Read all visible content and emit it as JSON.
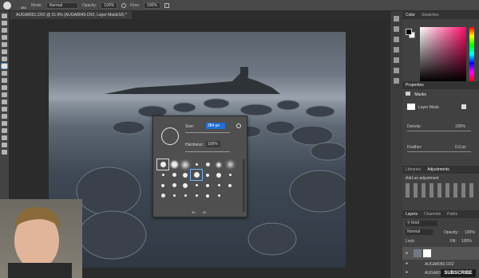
{
  "options_bar": {
    "brush_size": "384",
    "mode_label": "Mode:",
    "mode_value": "Normal",
    "opacity_label": "Opacity:",
    "opacity_value": "100%",
    "flow_label": "Flow:",
    "flow_value": "100%"
  },
  "document": {
    "tab_title": "AUGA8051.CR2 @ 31.9% (AUGA8049.CR2, Layer Mask/16) *"
  },
  "brush_popup": {
    "size_label": "Size:",
    "size_value": "384 px",
    "hardness_label": "Hardness:",
    "hardness_value": "100%",
    "brush_nums": [
      "35",
      "60"
    ]
  },
  "color_panel": {
    "tabs": [
      "Color",
      "Swatches"
    ]
  },
  "properties": {
    "title": "Properties",
    "masks_label": "Masks",
    "layer_mask_label": "Layer Mask",
    "density_label": "Density:",
    "density_value": "100%",
    "feather_label": "Feather:",
    "feather_value": "0.0 px"
  },
  "adjustments": {
    "tabs": [
      "Libraries",
      "Adjustments"
    ],
    "add_label": "Add an adjustment"
  },
  "layers": {
    "tabs": [
      "Layers",
      "Channels",
      "Paths"
    ],
    "kind_label": "Kind",
    "blend_mode": "Normal",
    "opacity_label": "Opacity:",
    "opacity_value": "100%",
    "lock_label": "Lock:",
    "fill_label": "Fill:",
    "fill_value": "100%",
    "rows": [
      "AUGA8050.CR2",
      "AUGA8051.CR2"
    ]
  },
  "subscribe": "SUBSCRIBE",
  "colors": {
    "accent": "#1f6fd6",
    "fg": "#000000",
    "bg": "#ffffff"
  }
}
